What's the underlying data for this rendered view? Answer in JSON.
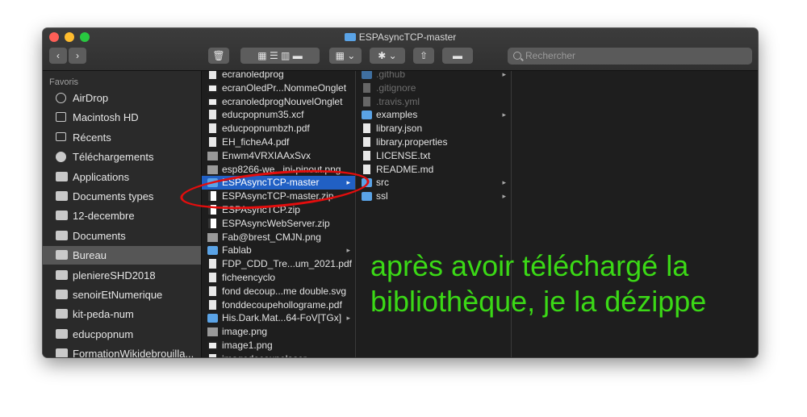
{
  "window": {
    "title": "ESPAsyncTCP-master"
  },
  "toolbar": {
    "nav_back": "‹",
    "nav_forward": "›",
    "trash": "🗑",
    "view_group": "▦ ☰ ▥ ▬",
    "arrange": "▦ ⌄",
    "action": "✱ ⌄",
    "share": "⇧",
    "tag": "▬"
  },
  "search": {
    "placeholder": "Rechercher"
  },
  "sidebar": {
    "heading": "Favoris",
    "items": [
      {
        "label": "AirDrop",
        "icon": "airdrop-icon"
      },
      {
        "label": "Macintosh HD",
        "icon": "drive-icon"
      },
      {
        "label": "Récents",
        "icon": "recents-icon"
      },
      {
        "label": "Téléchargements",
        "icon": "downloads-icon"
      },
      {
        "label": "Applications",
        "icon": "applications-icon"
      },
      {
        "label": "Documents types",
        "icon": "folder-icon"
      },
      {
        "label": "12-decembre",
        "icon": "folder-icon"
      },
      {
        "label": "Documents",
        "icon": "documents-icon"
      },
      {
        "label": "Bureau",
        "icon": "desktop-icon",
        "selected": true
      },
      {
        "label": "pleniereSHD2018",
        "icon": "folder-icon"
      },
      {
        "label": "senoirEtNumerique",
        "icon": "folder-icon"
      },
      {
        "label": "kit-peda-num",
        "icon": "folder-icon"
      },
      {
        "label": "educpopnum",
        "icon": "folder-icon"
      },
      {
        "label": "FormationWikidebrouilla...",
        "icon": "folder-icon"
      }
    ]
  },
  "column1": {
    "items": [
      {
        "label": "ecranoledprog",
        "icon": "doc"
      },
      {
        "label": "ecranOledPr...NommeOnglet",
        "icon": "dark"
      },
      {
        "label": "ecranoledprogNouvelOnglet",
        "icon": "dark"
      },
      {
        "label": "educpopnum35.xcf",
        "icon": "doc"
      },
      {
        "label": "educpopnumbzh.pdf",
        "icon": "doc"
      },
      {
        "label": "EH_ficheA4.pdf",
        "icon": "doc"
      },
      {
        "label": "Enwm4VRXIAAxSvx",
        "icon": "img"
      },
      {
        "label": "esp8266-we...ini-pinout.png",
        "icon": "img"
      },
      {
        "label": "ESPAsyncTCP-master",
        "icon": "folder",
        "selected": true,
        "chevron": "▸"
      },
      {
        "label": "ESPAsyncTCP-master.zip",
        "icon": "zip"
      },
      {
        "label": "ESPAsyncTCP.zip",
        "icon": "zip"
      },
      {
        "label": "ESPAsyncWebServer.zip",
        "icon": "zip"
      },
      {
        "label": "Fab@brest_CMJN.png",
        "icon": "img"
      },
      {
        "label": "Fablab",
        "icon": "folder",
        "chevron": "▸"
      },
      {
        "label": "FDP_CDD_Tre...um_2021.pdf",
        "icon": "doc"
      },
      {
        "label": "ficheencyclo",
        "icon": "doc"
      },
      {
        "label": "fond decoup...me double.svg",
        "icon": "doc"
      },
      {
        "label": "fonddecoupehollograme.pdf",
        "icon": "doc"
      },
      {
        "label": "His.Dark.Mat...64-FoV[TGx]",
        "icon": "folder",
        "chevron": "▸"
      },
      {
        "label": "image.png",
        "icon": "img"
      },
      {
        "label": "image1.png",
        "icon": "dark"
      },
      {
        "label": "imagedecoupelaser",
        "icon": "doc"
      }
    ]
  },
  "column2": {
    "items": [
      {
        "label": ".github",
        "icon": "folder",
        "dim": true,
        "chevron": "▸"
      },
      {
        "label": ".gitignore",
        "icon": "doc",
        "dim": true
      },
      {
        "label": ".travis.yml",
        "icon": "doc",
        "dim": true
      },
      {
        "label": "examples",
        "icon": "folder",
        "chevron": "▸"
      },
      {
        "label": "library.json",
        "icon": "doc"
      },
      {
        "label": "library.properties",
        "icon": "doc"
      },
      {
        "label": "LICENSE.txt",
        "icon": "doc"
      },
      {
        "label": "README.md",
        "icon": "doc"
      },
      {
        "label": "src",
        "icon": "folder",
        "chevron": "▸"
      },
      {
        "label": "ssl",
        "icon": "folder",
        "chevron": "▸"
      }
    ]
  },
  "annotation": {
    "line1": "après avoir téléchargé la",
    "line2": "bibliothèque, je la dézippe",
    "text_color": "#3bd916",
    "ellipse_color": "#e30d0d"
  }
}
